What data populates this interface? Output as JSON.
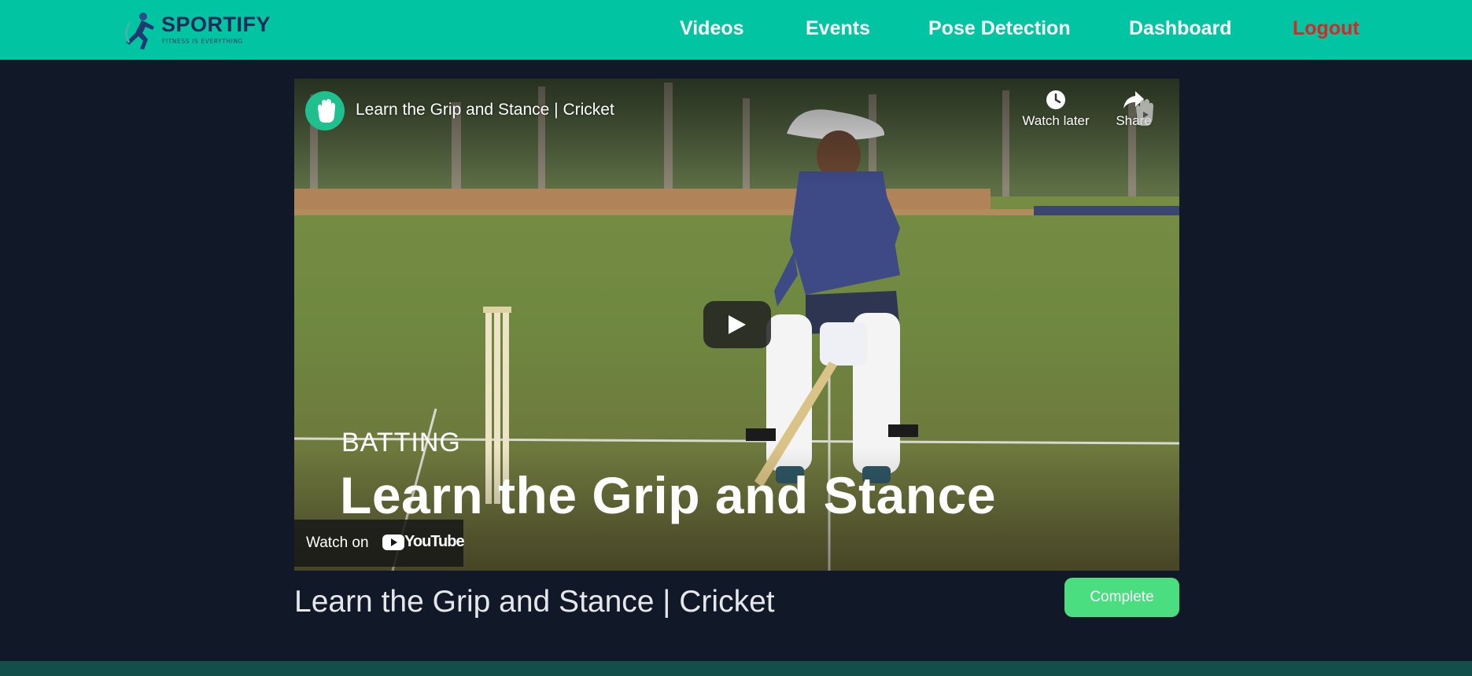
{
  "colors": {
    "navbar": "#00c4a2",
    "page_background": "#111827",
    "logout": "#dc2626",
    "complete_button": "#4ade80",
    "footer": "#134e4a"
  },
  "brand": {
    "name": "SPORTIFY",
    "tagline": "FITNESS IS EVERYTHING",
    "logo_icon": "runner-icon"
  },
  "nav": {
    "items": [
      {
        "label": "Videos"
      },
      {
        "label": "Events"
      },
      {
        "label": "Pose Detection"
      },
      {
        "label": "Dashboard"
      },
      {
        "label": "Logout"
      }
    ]
  },
  "video": {
    "title": "Learn the Grip and Stance | Cricket",
    "channel_icon": "hand-icon",
    "actions": {
      "watch_later": "Watch later",
      "share": "Share"
    },
    "overlay": {
      "kicker": "BATTING",
      "headline": "Learn the Grip and Stance"
    },
    "watch_on": {
      "label": "Watch on",
      "platform": "YouTube"
    }
  },
  "page": {
    "title": "Learn the Grip and Stance | Cricket",
    "complete_label": "Complete"
  }
}
